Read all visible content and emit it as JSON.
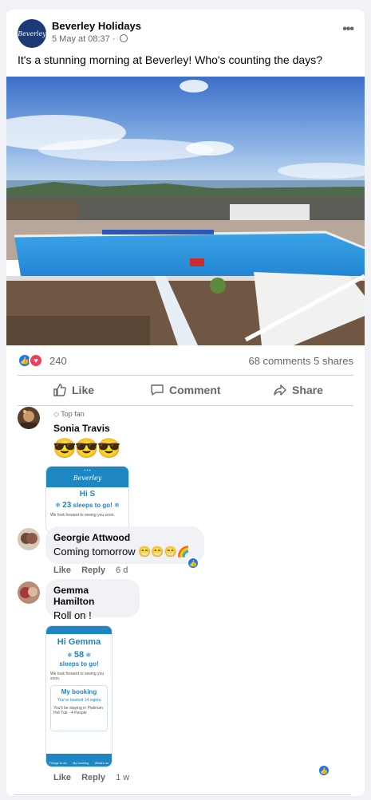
{
  "post": {
    "page_name": "Beverley Holidays",
    "logo_text": "Beverley",
    "date": "5 May at 08:37 ·",
    "more_icon": "more-horizontal-icon",
    "text": "It's a stunning morning at Beverley! Who's counting the days?"
  },
  "stats": {
    "reactions": "240",
    "comments_shares": "68 comments  5 shares"
  },
  "actions": {
    "like": "Like",
    "comment": "Comment",
    "share": "Share"
  },
  "comments": [
    {
      "badge": "Top fan",
      "name": "Sonia Travis",
      "text": "😎😎😎",
      "screenshot": {
        "brand": "Beverley",
        "greeting": "Hi S",
        "count": "23",
        "count_text": "sleeps to go!",
        "footer": "We look forward to seeing you soon."
      }
    },
    {
      "name": "Georgie Attwood",
      "text": "Coming tomorrow 😁😁😁🌈",
      "like": "Like",
      "reply": "Reply",
      "time": "6 d"
    },
    {
      "name": "Gemma Hamilton",
      "text": "Roll on !",
      "like": "Like",
      "reply": "Reply",
      "time": "1 w",
      "screenshot": {
        "greeting": "Hi Gemma",
        "count": "58",
        "count_text": "sleeps to go!",
        "footer": "We look forward to seeing you soon.",
        "booking_title": "My booking",
        "booking_sub": "You've booked 14 nights",
        "booking_body": "You'll be staying in Platinum Hot Tub - 4 People",
        "nav": [
          "Things to do",
          "My booking",
          "What's on"
        ]
      }
    }
  ],
  "colors": {
    "accent": "#1877f2",
    "love": "#f33e58",
    "brand": "#1d3a78",
    "app_blue": "#1f86c4"
  }
}
